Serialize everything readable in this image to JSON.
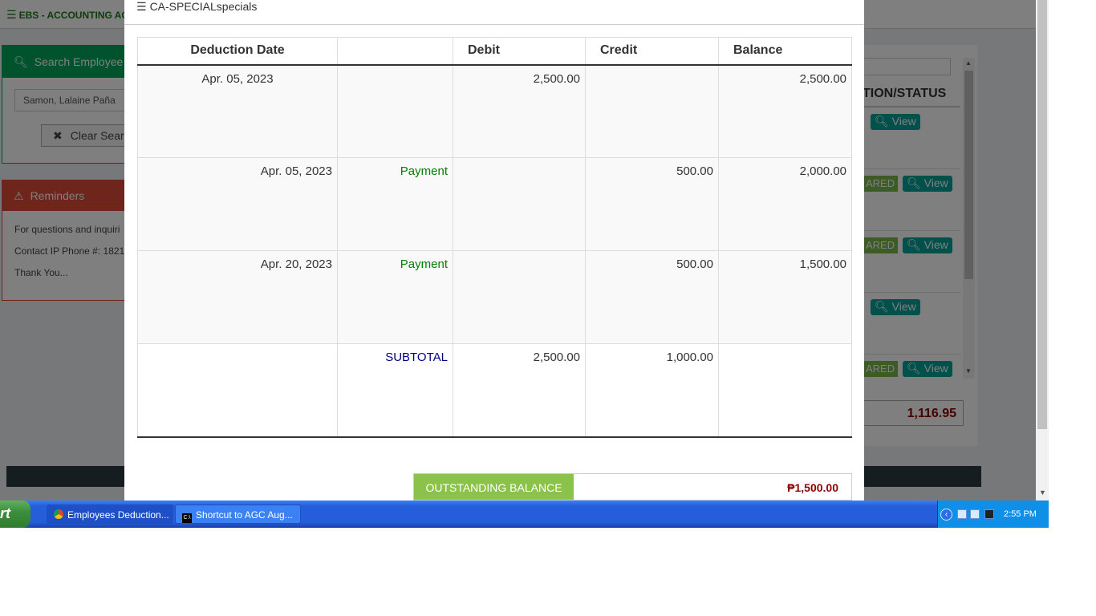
{
  "app": {
    "title": "EBS - ACCOUNTING AC"
  },
  "search": {
    "title": "Search Employee",
    "employee_value": "Samon, Lalaine Paña",
    "clear_label": "Clear Sear"
  },
  "reminders": {
    "title": "Reminders",
    "lines": [
      "For questions and inquiri",
      "Contact IP Phone #: 1821",
      "Thank You..."
    ]
  },
  "status_panel": {
    "header": "TION/STATUS",
    "cleared_label": "ARED",
    "view_label": "View",
    "total": "1,116.95"
  },
  "modal": {
    "title": "CA-SPECIALspecials",
    "columns": [
      "Deduction Date",
      "",
      "Debit",
      "Credit",
      "Balance"
    ],
    "rows": [
      {
        "date": "Apr. 05, 2023",
        "type": "",
        "debit": "2,500.00",
        "credit": "",
        "balance": "2,500.00"
      },
      {
        "date": "Apr. 05, 2023",
        "type": "Payment",
        "debit": "",
        "credit": "500.00",
        "balance": "2,000.00"
      },
      {
        "date": "Apr. 20, 2023",
        "type": "Payment",
        "debit": "",
        "credit": "500.00",
        "balance": "1,500.00"
      }
    ],
    "subtotal": {
      "label": "SUBTOTAL",
      "debit": "2,500.00",
      "credit": "1,000.00"
    },
    "outstanding": {
      "label": "OUTSTANDING BALANCE",
      "value": "₱1,500.00"
    }
  },
  "taskbar": {
    "start_label": "rt",
    "tasks": [
      "Employees Deduction...",
      "Shortcut to AGC Aug..."
    ],
    "clock": "2:55 PM"
  },
  "colors": {
    "accent_green": "#00a65a",
    "reminder_red": "#dd4b39",
    "outstanding_green": "#8bc34a",
    "balance_red": "#8b0000",
    "view_teal": "#00a097"
  }
}
